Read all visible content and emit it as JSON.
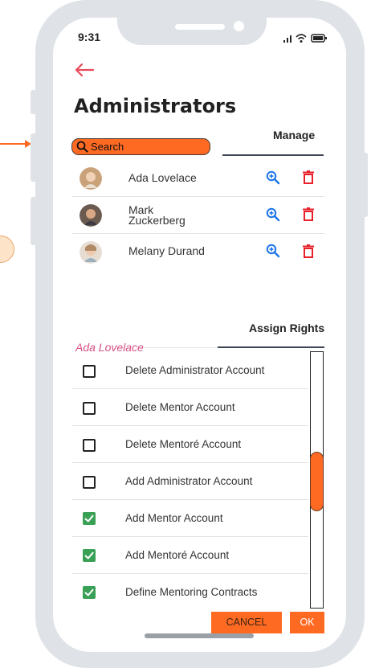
{
  "status_bar": {
    "time": "9:31",
    "icons": ".ıl ᯤ ▭"
  },
  "header": {
    "back_icon": "arrow-left-icon",
    "title": "Administrators"
  },
  "search": {
    "label": "Search"
  },
  "manage": {
    "tab_label": "Manage",
    "admins": [
      {
        "name_line1": "Ada Lovelace",
        "name_line2": ""
      },
      {
        "name_line1": "Mark",
        "name_line2": "Zuckerberg"
      },
      {
        "name_line1": "Melany Durand",
        "name_line2": ""
      }
    ]
  },
  "rights": {
    "tab_label": "Assign Rights",
    "selected_user": "Ada Lovelace",
    "items": [
      {
        "label": "Delete Administrator Account",
        "checked": false
      },
      {
        "label": "Delete Mentor Account",
        "checked": false
      },
      {
        "label": "Delete Mentoré Account",
        "checked": false
      },
      {
        "label": "Add Administrator Account",
        "checked": false
      },
      {
        "label": "Add Mentor Account",
        "checked": true
      },
      {
        "label": "Add Mentoré Account",
        "checked": true
      },
      {
        "label": "Define Mentoring Contracts",
        "checked": true
      }
    ]
  },
  "actions": {
    "cancel_label": "CANCEL",
    "ok_label": "OK"
  },
  "colors": {
    "accent": "#ff6a23",
    "danger": "#e8202a",
    "link_blue": "#1a73e8",
    "check_green": "#3aa055",
    "user_pink": "#d94f86"
  }
}
